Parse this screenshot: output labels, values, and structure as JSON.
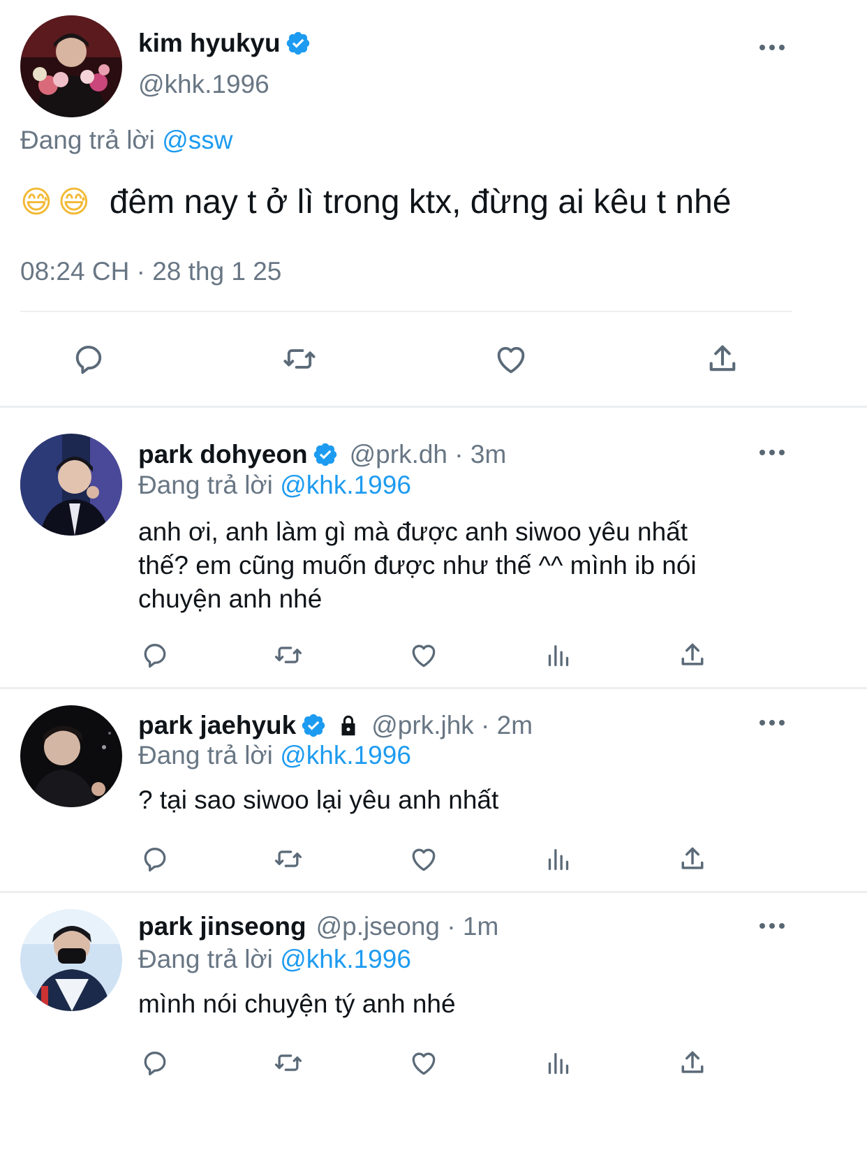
{
  "main_tweet": {
    "display_name": "kim hyukyu",
    "handle": "@khk.1996",
    "replying_prefix": "Đang trả lời",
    "replying_to": "@ssw",
    "emoji": "😅😅",
    "text": "đêm nay t ở lì trong ktx, đừng ai kêu t nhé",
    "timestamp": "08:24 CH · 28 thg 1 25"
  },
  "replies": [
    {
      "display_name": "park dohyeon",
      "handle": "@prk.dh · 3m",
      "replying_prefix": "Đang trả lời",
      "replying_to": "@khk.1996",
      "text_lines": [
        "anh ơi, anh làm gì mà được anh siwoo yêu nhất",
        "thế? em cũng muốn được như thế ^^ mình ib nói",
        "chuyện anh nhé"
      ]
    },
    {
      "display_name": "park jaehyuk",
      "handle": "@prk.jhk · 2m",
      "replying_prefix": "Đang trả lời",
      "replying_to": "@khk.1996",
      "text": "? tại sao siwoo lại yêu anh nhất"
    },
    {
      "display_name": "park jinseong",
      "handle": "@p.jseong · 1m",
      "replying_prefix": "Đang trả lời",
      "replying_to": "@khk.1996",
      "text": "mình nói chuyện tý anh nhé"
    }
  ],
  "colors": {
    "link": "#1d9bf0",
    "secondary_text": "#687684",
    "icon": "#5b6a78",
    "divider": "#eceef0"
  }
}
